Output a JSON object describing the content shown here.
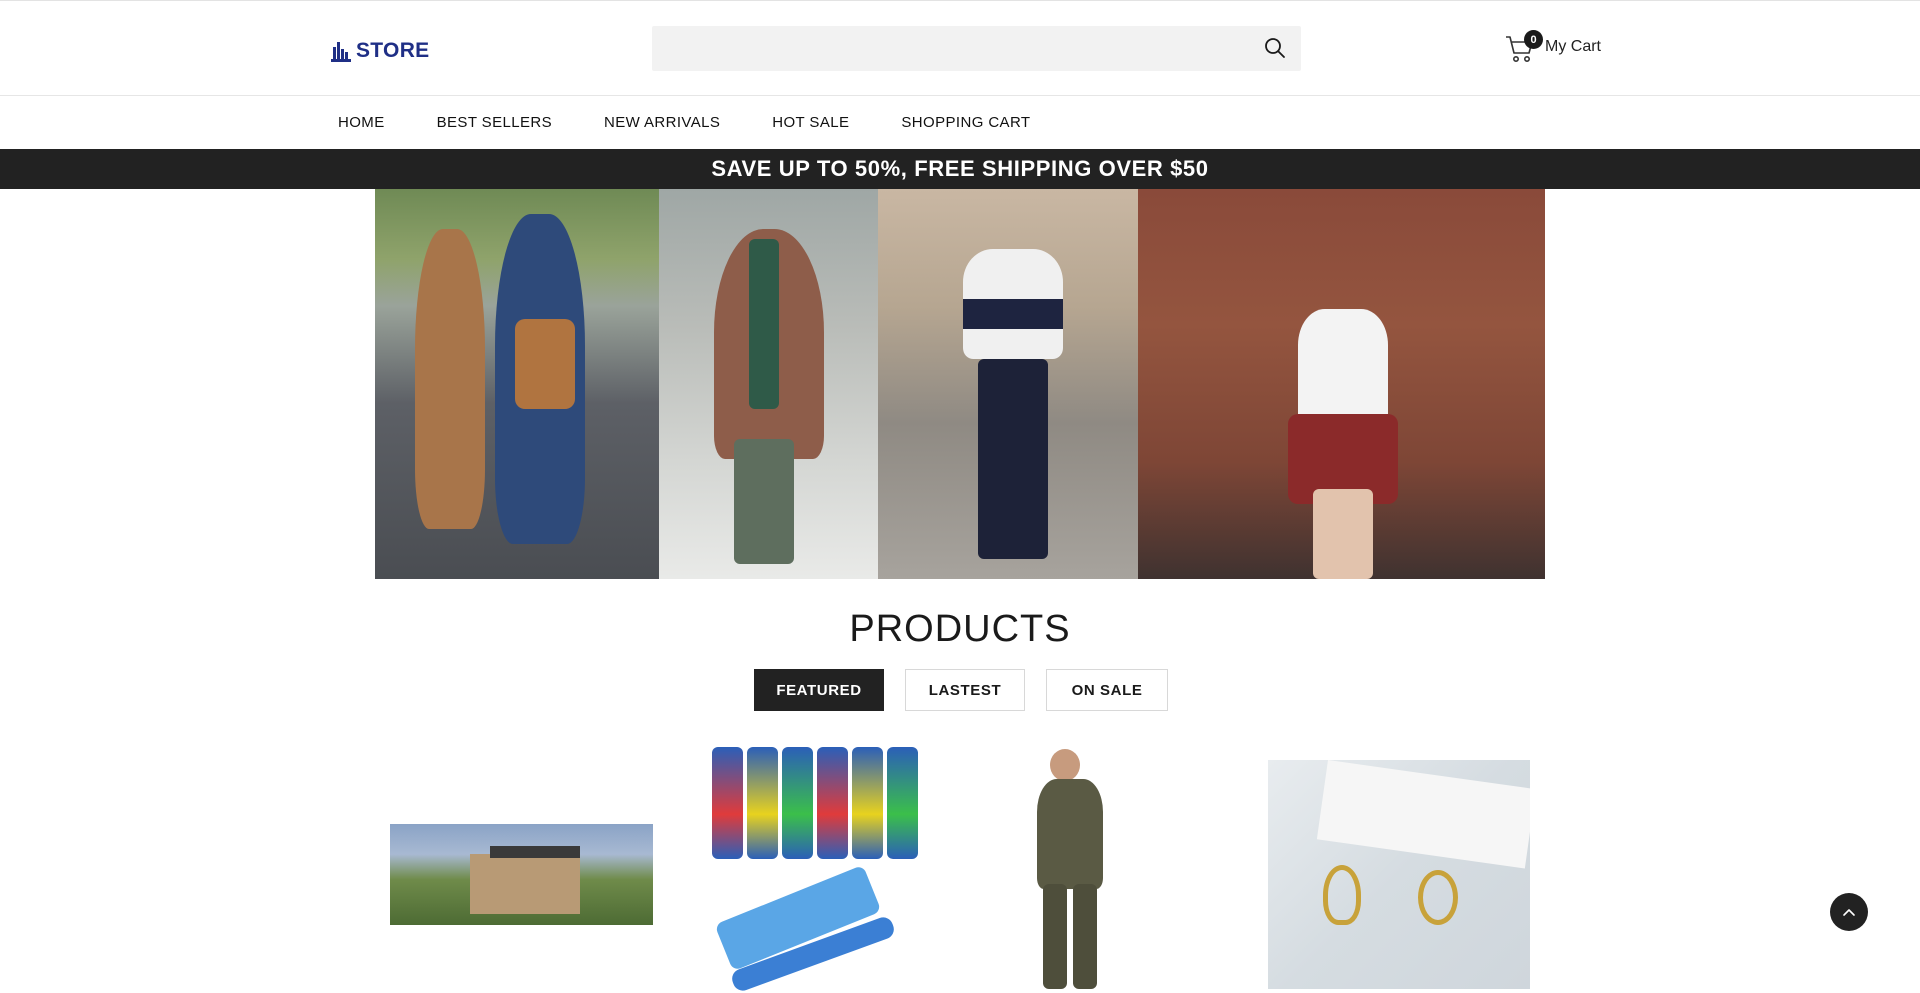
{
  "header": {
    "logo_text": "STORE",
    "search_placeholder": "",
    "cart_count": "0",
    "cart_label": "My Cart"
  },
  "nav": {
    "items": [
      {
        "label": "HOME"
      },
      {
        "label": "BEST SELLERS"
      },
      {
        "label": "NEW ARRIVALS"
      },
      {
        "label": "HOT SALE"
      },
      {
        "label": "SHOPPING CART"
      }
    ]
  },
  "promo": {
    "text": "SAVE UP TO 50%, FREE SHIPPING OVER $50"
  },
  "products": {
    "title": "PRODUCTS",
    "tabs": [
      {
        "label": "FEATURED",
        "active": true
      },
      {
        "label": "LASTEST",
        "active": false
      },
      {
        "label": "ON SALE",
        "active": false
      }
    ]
  },
  "colors": {
    "brand": "#1f2f86",
    "dark": "#222222"
  }
}
